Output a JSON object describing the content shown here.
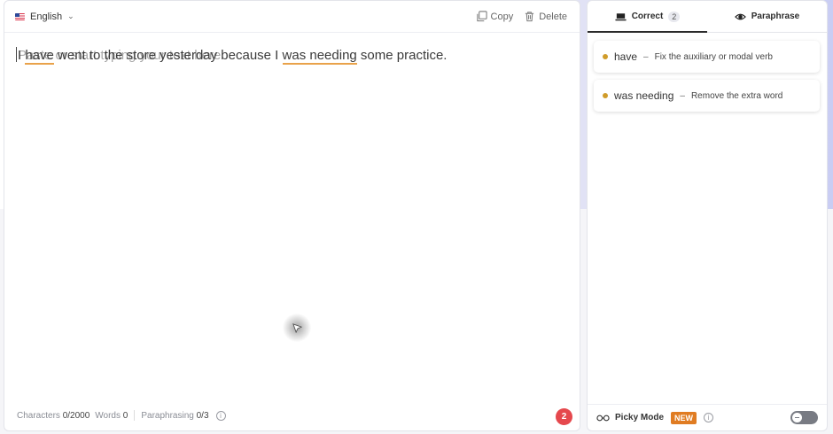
{
  "editor": {
    "language": "English",
    "copy_label": "Copy",
    "delete_label": "Delete",
    "text": {
      "part1": "I ",
      "err1": "have",
      "part2": " went to the store yesterday because I ",
      "err2": "was needing",
      "part3": " some practice."
    },
    "ghost_text": "Paste or start typing your text here",
    "footer": {
      "characters_label": "Characters",
      "characters_value": "0/2000",
      "words_label": "Words",
      "words_value": "0",
      "paraphrasing_label": "Paraphrasing",
      "paraphrasing_value": "0/3"
    },
    "error_count": "2"
  },
  "panel": {
    "tabs": [
      {
        "label": "Correct",
        "badge": "2"
      },
      {
        "label": "Paraphrase"
      }
    ],
    "suggestions": [
      {
        "word": "have",
        "dash": "–",
        "description": "Fix the auxiliary or modal verb"
      },
      {
        "word": "was needing",
        "dash": "–",
        "description": "Remove the extra word"
      }
    ],
    "footer": {
      "picky_label": "Picky Mode",
      "new_badge": "NEW"
    }
  },
  "colors": {
    "error_underline": "#e9a24a",
    "error_badge": "#e5484d",
    "suggestion_dot": "#d09c2a",
    "new_badge": "#e07c22"
  },
  "icons": [
    "us-flag-icon",
    "chevron-down-icon",
    "copy-icon",
    "trash-icon",
    "info-icon",
    "laptop-icon",
    "paraphrase-icon",
    "glasses-icon",
    "toggle-off-icon",
    "cursor-icon"
  ]
}
